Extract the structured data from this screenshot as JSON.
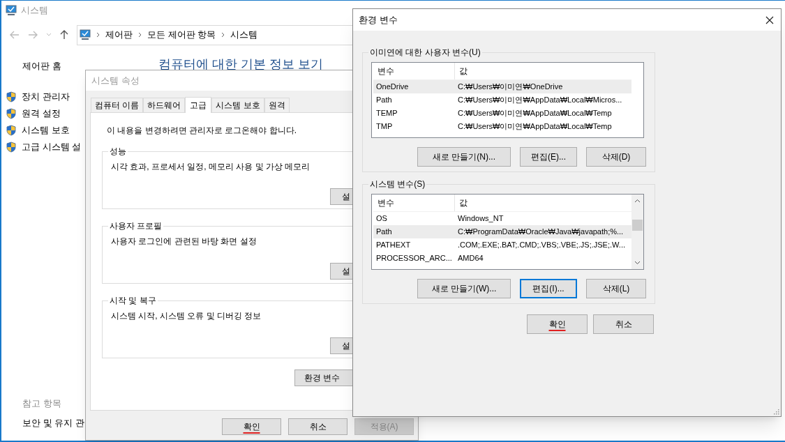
{
  "system_window": {
    "title": "시스템",
    "breadcrumb": [
      "제어판",
      "모든 제어판 항목",
      "시스템"
    ],
    "home_link": "제어판 홈",
    "links": [
      "장치 관리자",
      "원격 설정",
      "시스템 보호",
      "고급 시스템 설"
    ],
    "heading": "컴퓨터에 대한 기본 정보 보기",
    "see_also_title": "참고 항목",
    "see_also": [
      "보안 및 유지 관"
    ]
  },
  "system_properties": {
    "title": "시스템 속성",
    "tabs": [
      {
        "label": "컴퓨터 이름",
        "selected": false
      },
      {
        "label": "하드웨어",
        "selected": false
      },
      {
        "label": "고급",
        "selected": true
      },
      {
        "label": "시스템 보호",
        "selected": false
      },
      {
        "label": "원격",
        "selected": false
      }
    ],
    "notice": "이 내용을 변경하려면 관리자로 로그온해야 합니다.",
    "groups": [
      {
        "title": "성능",
        "description": "시각 효과, 프로세서 일정, 메모리 사용 및 가상 메모리",
        "button": "설"
      },
      {
        "title": "사용자 프로필",
        "description": "사용자 로그인에 관련된 바탕 화면 설정",
        "button": "설"
      },
      {
        "title": "시작 및 복구",
        "description": "시스템 시작, 시스템 오류 및 디버깅 정보",
        "button": "설"
      }
    ],
    "env_button": "환경 변수",
    "buttons": [
      {
        "label": "확인",
        "disabled": false,
        "annotated": true
      },
      {
        "label": "취소",
        "disabled": false,
        "annotated": false
      },
      {
        "label": "적용(A)",
        "disabled": true,
        "annotated": false
      }
    ]
  },
  "environment_dialog": {
    "title": "환경 변수",
    "user_variables": {
      "title": "이미연에 대한 사용자 변수(U)",
      "columns": [
        "변수",
        "값"
      ],
      "rows": [
        {
          "name": "OneDrive",
          "value": "C:₩Users₩이미연₩OneDrive",
          "selected": true
        },
        {
          "name": "Path",
          "value": "C:₩Users₩이미연₩AppData₩Local₩Micros...",
          "selected": false
        },
        {
          "name": "TEMP",
          "value": "C:₩Users₩이미연₩AppData₩Local₩Temp",
          "selected": false
        },
        {
          "name": "TMP",
          "value": "C:₩Users₩이미연₩AppData₩Local₩Temp",
          "selected": false
        }
      ],
      "buttons": [
        {
          "label": "새로 만들기(N)...",
          "focused": false
        },
        {
          "label": "편집(E)...",
          "focused": false
        },
        {
          "label": "삭제(D)",
          "focused": false
        }
      ]
    },
    "system_variables": {
      "title": "시스템 변수(S)",
      "columns": [
        "변수",
        "값"
      ],
      "rows": [
        {
          "name": "OS",
          "value": "Windows_NT",
          "selected": false
        },
        {
          "name": "Path",
          "value": "C:₩ProgramData₩Oracle₩Java₩javapath;%...",
          "selected": true
        },
        {
          "name": "PATHEXT",
          "value": ".COM;.EXE;.BAT;.CMD;.VBS;.VBE;.JS;.JSE;.W...",
          "selected": false
        },
        {
          "name": "PROCESSOR_ARC...",
          "value": "AMD64",
          "selected": false
        }
      ],
      "buttons": [
        {
          "label": "새로 만들기(W)...",
          "focused": false
        },
        {
          "label": "편집(I)...",
          "focused": true
        },
        {
          "label": "삭제(L)",
          "focused": false
        }
      ]
    },
    "buttons": [
      {
        "label": "확인",
        "annotated": true
      },
      {
        "label": "취소",
        "annotated": false
      }
    ]
  }
}
